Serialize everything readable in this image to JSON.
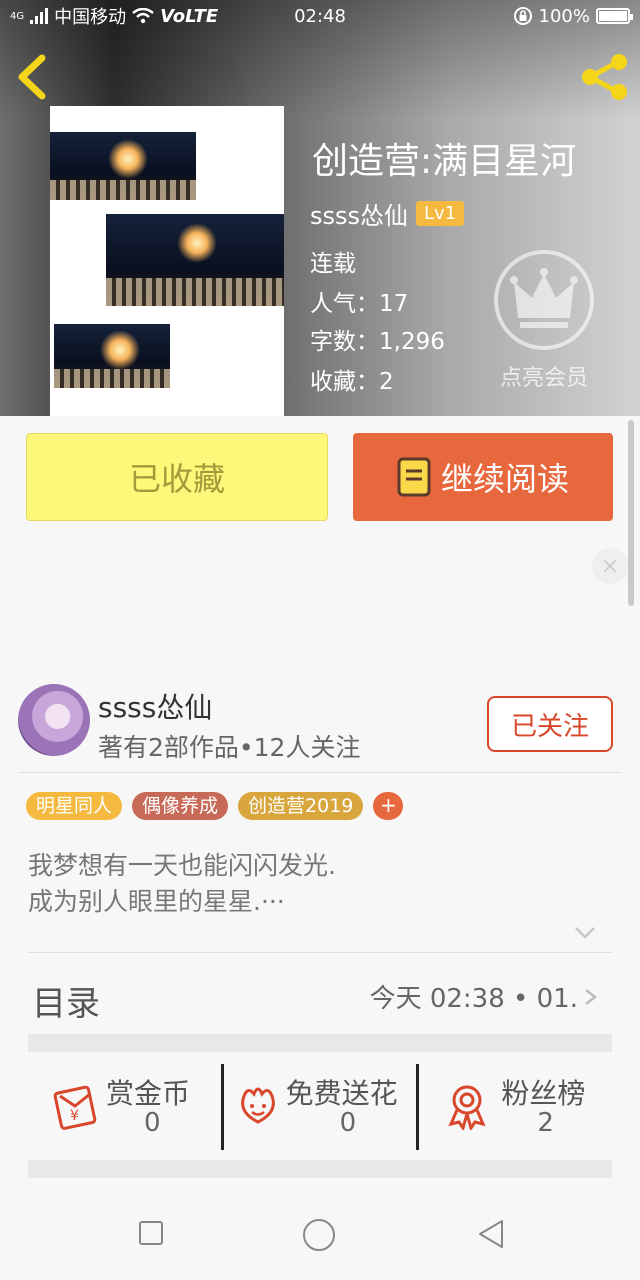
{
  "status_bar": {
    "network": "4G",
    "carrier": "中国移动",
    "volte": "VoLTE",
    "time": "02:48",
    "battery": "100%"
  },
  "book": {
    "title": "创造营:满目星河",
    "author": "ssss怂仙",
    "level": "Lv1",
    "status": "连载",
    "popularity": "人气：17",
    "word_count": "字数：1,296",
    "favorites": "收藏：2",
    "vip_label": "点亮会员"
  },
  "actions": {
    "collected": "已收藏",
    "continue_reading": "继续阅读"
  },
  "author_card": {
    "name": "ssss怂仙",
    "stats": "著有2部作品•12人关注",
    "follow": "已关注"
  },
  "tags": [
    {
      "label": "明星同人",
      "color": "#f4b93e"
    },
    {
      "label": "偶像养成",
      "color": "#c86a58"
    },
    {
      "label": "创造营2019",
      "color": "#d8a63c"
    }
  ],
  "tag_add": "+",
  "description": {
    "line1": "我梦想有一天也能闪闪发光.",
    "line2": "成为别人眼里的星星.···"
  },
  "toc": {
    "title": "目录",
    "latest": "今天 02:38 • 01."
  },
  "rewards": [
    {
      "label": "赏金币",
      "value": "0",
      "icon": "red-envelope-icon"
    },
    {
      "label": "免费送花",
      "value": "0",
      "icon": "flower-icon"
    },
    {
      "label": "粉丝榜",
      "value": "2",
      "icon": "medal-icon"
    }
  ],
  "colors": {
    "accent_orange": "#e8683e",
    "collect_yellow": "#fef87a",
    "follow_red": "#d9472b"
  }
}
